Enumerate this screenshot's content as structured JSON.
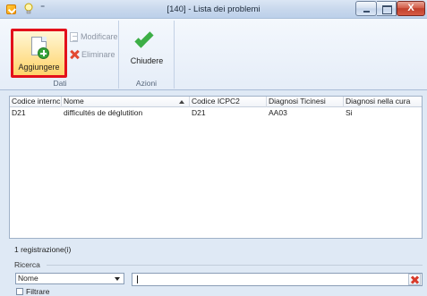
{
  "window": {
    "title": "[140] - Lista dei problemi",
    "quick_access_separator": "⁼",
    "close_glyph": "X"
  },
  "ribbon": {
    "groups": [
      {
        "label": "Dati"
      },
      {
        "label": "Azioni"
      }
    ],
    "add_label": "Aggiungere",
    "modify_label": "Modificare",
    "delete_label": "Eliminare",
    "close_label": "Chiudere"
  },
  "grid": {
    "columns": [
      "Codice internc",
      "Nome",
      "Codice ICPC2",
      "Diagnosi Ticinesi",
      "Diagnosi nella cura"
    ],
    "sorted_column": "Nome",
    "rows": [
      [
        "D21",
        "difficultés de déglutition",
        "D21",
        "AA03",
        "Si"
      ]
    ]
  },
  "footer": {
    "record_count": "1 registrazione(i)",
    "search_group_label": "Ricerca",
    "search_field_selected": "Nome",
    "search_value": "",
    "filter_label": "Filtrare",
    "filter_checked": false
  },
  "colors": {
    "highlight_border": "#e3101b",
    "add_green": "#37a23a",
    "check_green": "#3cae46",
    "delete_red": "#e24a33"
  }
}
